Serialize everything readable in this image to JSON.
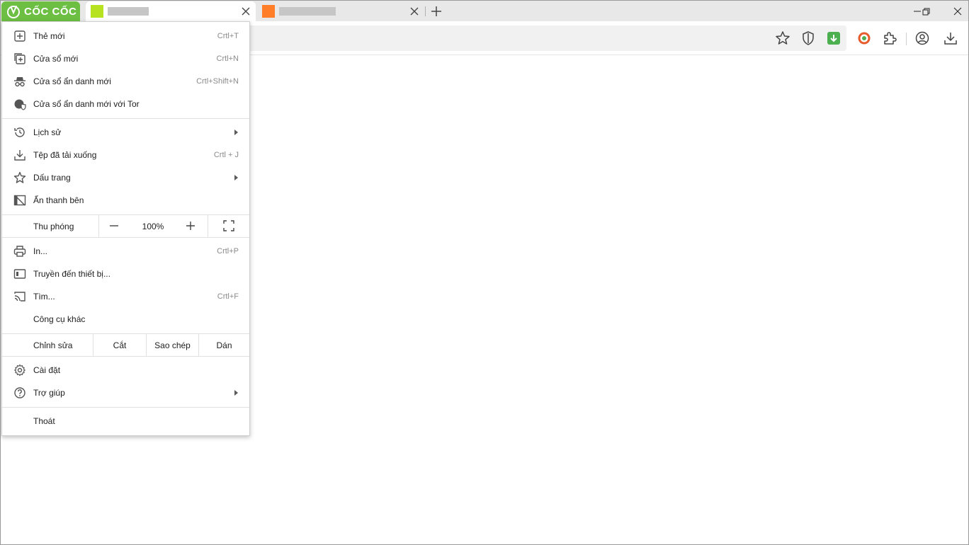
{
  "brand": {
    "name": "CỐC CỐC",
    "accent": "#6cbf43"
  },
  "tabs": [
    {
      "favicon_color": "#b7e21f",
      "active": true
    },
    {
      "favicon_color": "#ff7e27",
      "active": false
    }
  ],
  "menu": {
    "group1": [
      {
        "label": "Thẻ mới",
        "shortcut": "Crtl+T",
        "icon": "new-tab-icon"
      },
      {
        "label": "Cửa sổ mới",
        "shortcut": "Crtl+N",
        "icon": "new-window-icon"
      },
      {
        "label": "Cửa sổ ẩn danh mới",
        "shortcut": "Crtl+Shift+N",
        "icon": "incognito-icon"
      },
      {
        "label": "Cửa sổ ẩn danh mới với Tor",
        "shortcut": "",
        "icon": "tor-globe-icon"
      }
    ],
    "group2": [
      {
        "label": "Lịch sử",
        "icon": "history-icon",
        "submenu": true
      },
      {
        "label": "Tệp đã tải xuống",
        "shortcut": "Crtl + J",
        "icon": "download-icon"
      },
      {
        "label": "Dấu trang",
        "icon": "star-icon",
        "submenu": true
      },
      {
        "label": "Ẩn thanh bên",
        "icon": "hide-sidebar-icon"
      }
    ],
    "zoom": {
      "label": "Thu phóng",
      "value": "100%"
    },
    "group3": [
      {
        "label": "In...",
        "shortcut": "Crtl+P",
        "icon": "print-icon"
      },
      {
        "label": "Truyền đến thiết bị...",
        "shortcut": "",
        "icon": "cast-device-icon"
      },
      {
        "label": "Tìm...",
        "shortcut": "Crtl+F",
        "icon": "cast-icon"
      },
      {
        "label": "Công cụ khác",
        "shortcut": "",
        "icon": ""
      }
    ],
    "edit": {
      "label": "Chỉnh sửa",
      "cut": "Cắt",
      "copy": "Sao chép",
      "paste": "Dán"
    },
    "group4": [
      {
        "label": "Cài đặt",
        "icon": "gear-icon"
      },
      {
        "label": "Trợ giúp",
        "icon": "help-icon",
        "submenu": true
      }
    ],
    "exit": {
      "label": "Thoát"
    }
  }
}
